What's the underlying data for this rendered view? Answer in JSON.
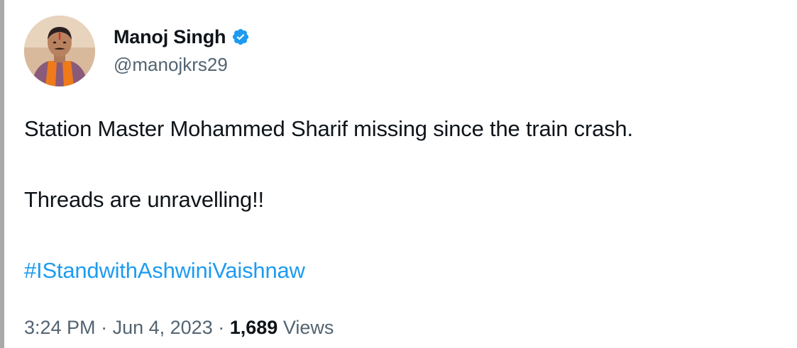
{
  "author": {
    "display_name": "Manoj Singh",
    "handle": "@manojkrs29",
    "verified": true,
    "verified_color": "#1d9bf0"
  },
  "tweet": {
    "paragraph_1": "Station Master Mohammed Sharif missing since the train crash.",
    "paragraph_2": "Threads are unravelling!!",
    "hashtag": "#IStandwithAshwiniVaishnaw"
  },
  "meta": {
    "time": "3:24 PM",
    "separator": "·",
    "date": "Jun 4, 2023",
    "views_count": "1,689",
    "views_label": "Views"
  },
  "colors": {
    "text": "#0f1419",
    "secondary": "#536471",
    "link": "#1d9bf0"
  }
}
